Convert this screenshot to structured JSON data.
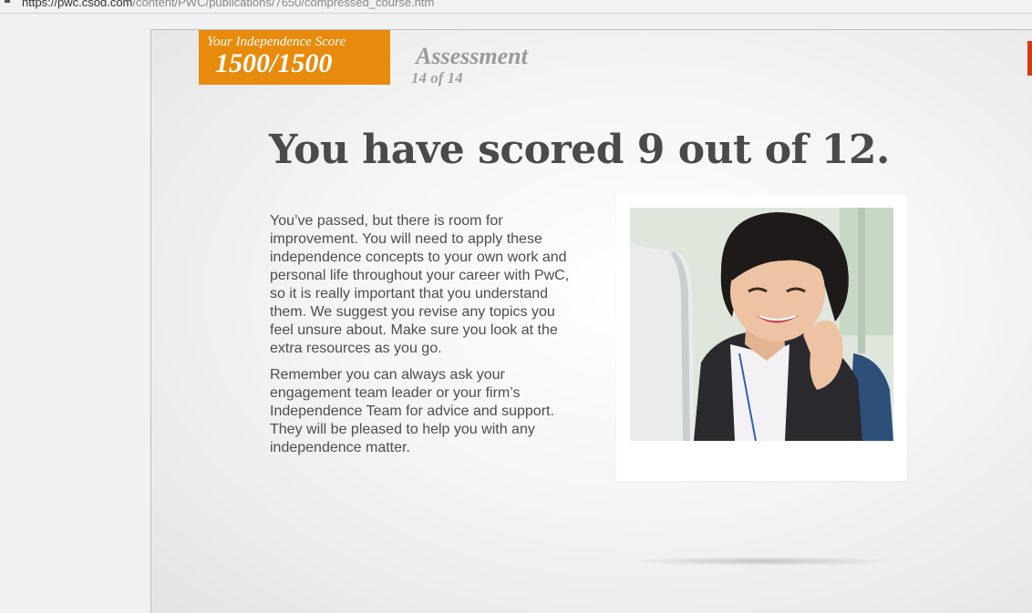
{
  "browser": {
    "url_host": "https://pwc.csod.com",
    "url_path": "/content/PWC/publications/7650/compressed_course.htm"
  },
  "course": {
    "score_label": "Your Independence Score",
    "score_value": "1500/1500",
    "section_title": "Assessment",
    "progress": "14 of 14",
    "headline": "You have scored 9 out of 12.",
    "paragraphs": [
      "You’ve passed, but there is room for improvement. You will need to apply these independence concepts to your own work and personal life throughout your career with PwC, so it is really important that you understand them. We suggest you revise any topics you feel unsure about. Make sure you look at the extra resources as you go.",
      "Remember you can always ask your engagement team leader or your firm’s Independence Team for advice and support. They will be pleased to help you with any independence matter."
    ]
  },
  "colors": {
    "score_box": "#e88a0b",
    "headline": "#4a4a4a",
    "accent_tab": "#d43a12"
  }
}
